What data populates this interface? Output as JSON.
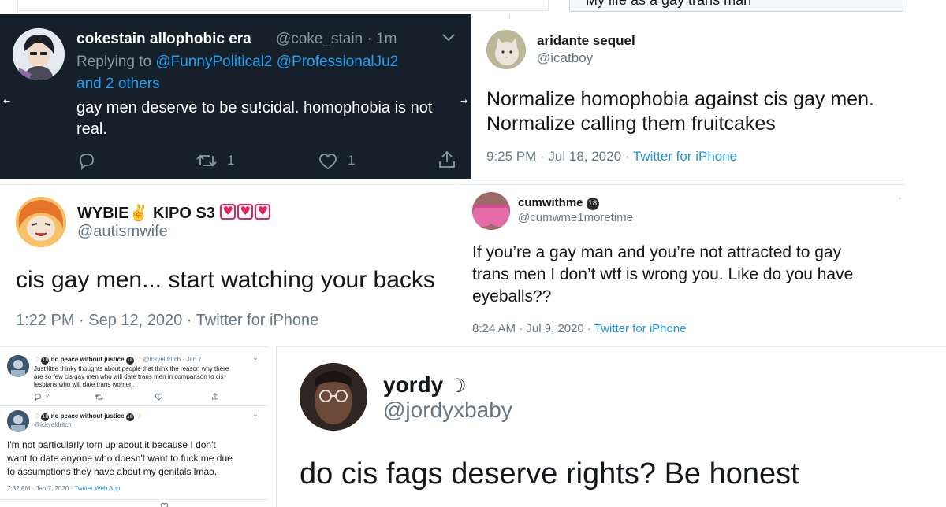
{
  "top_strip": {
    "right_text": "My life as a gay trans man"
  },
  "tweet1": {
    "display_name": "cokestain allophobic era",
    "handle_time": "@coke_stain · 1m",
    "replying_prefix": "Replying to",
    "reply_mention1": "@FunnyPolitical2",
    "reply_mention2": "@ProfessionalJu2",
    "reply_others": "and 2 others",
    "text_line1": "gay men deserve to be su!cidal. homophobia is not",
    "text_line2": "real.",
    "retweet_count": "1",
    "like_count": "1",
    "colors": {
      "background": "#15202b",
      "accent": "#1da1f2"
    },
    "icons": [
      "reply-icon",
      "retweet-icon",
      "like-icon",
      "share-icon",
      "chevron-down-icon"
    ]
  },
  "tweet2": {
    "display_name": "aridante sequel",
    "handle": "@icatboy",
    "text_line1": "Normalize homophobia against cis gay men.",
    "text_line2": "Normalize calling them fruitcakes",
    "timestamp": "9:25 PM · Jul 18, 2020 · ",
    "client": "Twitter for iPhone"
  },
  "tweet3": {
    "display_name": "WYBIE✌ KIPO S3",
    "handle": "@autismwife",
    "text": "cis gay men... start watching your backs",
    "timestamp": "1:22 PM · Sep 12, 2020 · Twitter for iPhone",
    "icons": [
      "heart-badge-icon",
      "heart-badge-icon",
      "heart-badge-icon"
    ]
  },
  "tweet4": {
    "display_name": "cumwithme",
    "badge": "18",
    "handle": "@cumwme1moretime",
    "text_line1": "If you’re a gay man and you’re not attracted to gay",
    "text_line2": "trans men I don’t wtf is wrong you. Like do you have",
    "text_line3": "eyeballs??",
    "timestamp": "8:24 AM · Jul 9, 2020 · ",
    "client": "Twitter for iPhone"
  },
  "tweet5": {
    "first": {
      "display_name": "no peace without justice",
      "handle_time": "@ickyeldritch · Jan 7",
      "text_line1": "Just little thinky thoughts about people that think the reason why there",
      "text_line2": "are so few cis gay men who will date trans men in comparison to cis",
      "text_line3": "lesbians who will date trans women.",
      "reply_count": "2"
    },
    "second": {
      "display_name": "no peace without justice",
      "handle": "@ickyeldritch",
      "text_line1": "I'm not particularly torn up about it because I don't",
      "text_line2": "want to date anyone who doesn't want to fuck me due",
      "text_line3": "to assumptions they have about my genitals lmao.",
      "timestamp": "7:32 AM · Jan 7, 2020 · ",
      "client": "Twitter Web App"
    },
    "badge": "18"
  },
  "tweet6": {
    "display_name": "yordy",
    "moon": "☽",
    "handle": "@jordyxbaby",
    "text": "do cis fags deserve rights? Be honest"
  }
}
